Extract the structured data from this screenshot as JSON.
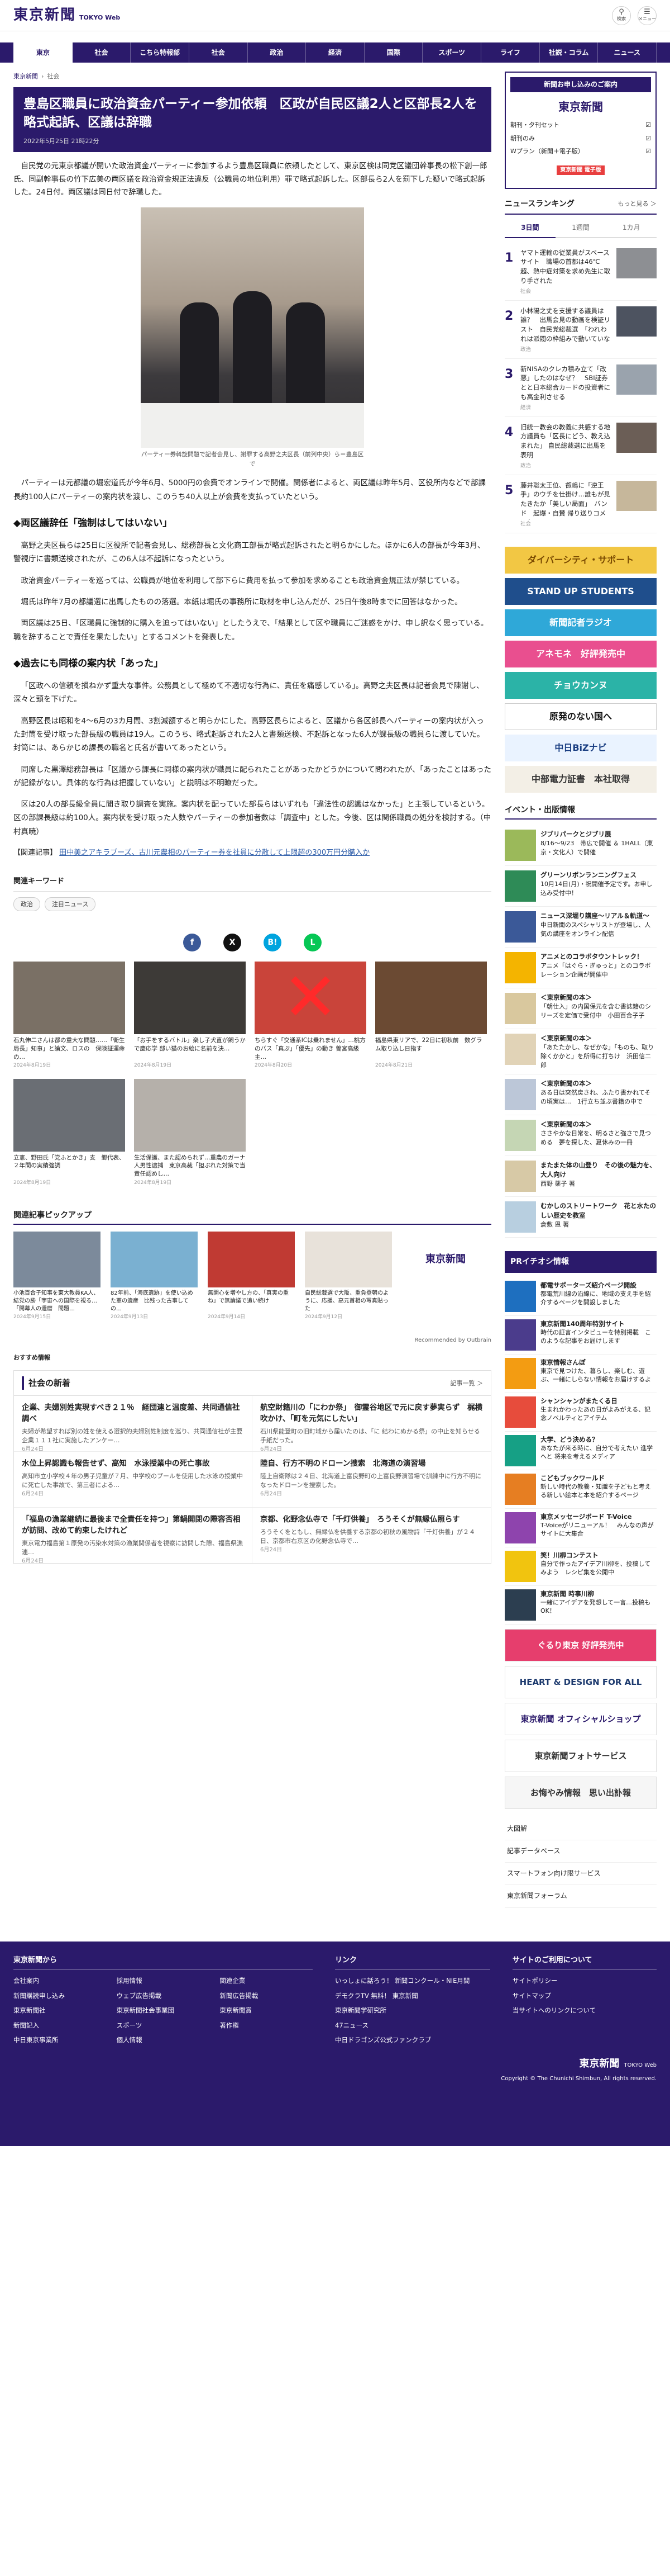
{
  "header": {
    "logo": "東京新聞",
    "logo_sub": "TOKYO Web",
    "search_label": "検索",
    "menu_label": "メニュー"
  },
  "nav": [
    "東京",
    "社会",
    "こちら特報部",
    "社会",
    "政治",
    "経済",
    "国際",
    "スポーツ",
    "ライフ",
    "社説・コラム",
    "ニュース"
  ],
  "breadcrumb": [
    "東京新聞",
    "社会"
  ],
  "article": {
    "title": "豊島区職員に政治資金パーティー参加依頼　区政が自民区議2人と区部長2人を略式起訴、区議は辞職",
    "date": "2022年5月25日 21時22分",
    "lead": "自民党の元東京都議が開いた政治資金パーティーに参加するよう豊島区職員に依頼したとして、東京区検は同党区議団幹事長の松下創一郎氏、同副幹事長の竹下広美の両区議を政治資金規正法違反（公職員の地位利用）罪で略式起訴した。区部長ら2人を罰下した疑いで略式起訴した。24日付。両区議は同日付で辞職した。",
    "photo_caption": "パーティー券斡旋問題で記者会見し、謝罪する高野之夫区長（前列中央）ら＝豊島区で",
    "paragraphs_1": [
      "パーティーは元都議の堀宏道氏が今年6月、5000円の会費でオンラインで開催。関係者によると、両区議は昨年5月、区役所内などで部課長約100人にパーティーの案内状を渡し、このうち40人以上が会費を支払っていたという。"
    ],
    "h2_1": "◆両区議辞任「強制はしてはいない」",
    "paragraphs_2": [
      "高野之夫区長らは25日に区役所で記者会見し、総務部長と文化商工部長が略式起訴されたと明らかにした。ほかに6人の部長が今年3月、警視庁に書類送検されたが、この6人は不起訴になったという。",
      "政治資金パーティーを巡っては、公職員が地位を利用して部下らに費用を払って参加を求めることも政治資金規正法が禁じている。",
      "堀氏は昨年7月の都議選に出馬したものの落選。本紙は堀氏の事務所に取材を申し込んだが、25日午後8時までに回答はなかった。",
      "両区議は25日、「区職員に強制的に購入を迫ってはいない」としたうえで、「結果として区や職員にご迷惑をかけ、申し訳なく思っている。職を辞することで責任を果たしたい」とするコメントを発表した。"
    ],
    "h2_2": "◆過去にも同様の案内状「あった」",
    "paragraphs_3": [
      "「区政への信頼を損ねかず重大な事件。公務員として極めて不適切な行為に、責任を痛感している」。高野之夫区長は記者会見で陳謝し、深々と頭を下げた。",
      "高野区長は昭和を4〜6月の3カ月間、3割減額すると明らかにした。高野区長らによると、区議から各区部長へパーティーの案内状が入った封筒を受け取った部長級の職員は19人。このうち、略式起訴された2人と書類送検、不起訴となった6人が課長級の職員らに渡していた。封筒には、あらかじめ課長の職名と氏名が書いてあったという。",
      "同席した黒澤総務部長は「区議から課長に同様の案内状が職員に配られたことがあったかどうかについて問われたが、「あったことはあったが記録がない。具体的な行為は把握していない」と説明は不明瞭だった。",
      "区は20人の部長級全員に聞き取り調査を実施。案内状を配っていた部長らはいずれも「違法性の認識はなかった」と主張しているという。区の部課長級は約100人。案内状を受け取った人数やパーティーの参加者数は「調査中」とした。今後、区は関係職員の処分を検討する。（中村真暁）"
    ],
    "related_label": "【関連記事】",
    "related_link": "田中美之アキラブーズ、古川元農相のパーティー券を社員に分散して上限超の300万円分購入か"
  },
  "keywords": {
    "title": "関連キーワード",
    "tags": [
      "政治",
      "注目ニュース"
    ]
  },
  "share": [
    {
      "icon": "facebook-icon",
      "glyph": "f",
      "color": "#3b5998"
    },
    {
      "icon": "x-icon",
      "glyph": "X",
      "color": "#111111"
    },
    {
      "icon": "hatena-icon",
      "glyph": "B!",
      "color": "#00a4de"
    },
    {
      "icon": "line-icon",
      "glyph": "L",
      "color": "#06c755"
    }
  ],
  "thumbs": [
    {
      "title": "石丸伸二さんは都の重大な問題……「衛生局長」知事」と論文、ロスの　保険証運命の…",
      "date": "2024年8月19日",
      "bg": "#7a7065"
    },
    {
      "title": "「お手をするバトル」楽し子犬直が飼うかで慶応学 部い猫のお絵に名前を決…",
      "date": "2024年8月19日",
      "bg": "#3d3a37"
    },
    {
      "title": "ちらすぐ「交通系ICは乗れません」…桃方のバス「真ぶ」「優先」の動き 曽宮高級主…",
      "date": "2024年8月20日",
      "bg": "#c9443a"
    },
    {
      "title": "福島県東リアで、22日に初秋前　数グラム取り込し日指す",
      "date": "2024年8月21日",
      "bg": "#6b4a33"
    },
    {
      "title": "立憲、野田氏「党ふとかき」支　郷代表、２年間の実績強調",
      "date": "2024年8月19日",
      "bg": "#6a6e74"
    },
    {
      "title": "生活保護、また認められず…重農のガーナ人男性逮捕　東京高裁「担ぶれた対策で当責任認めし…",
      "date": "2024年8月19日",
      "bg": "#b5b0aa"
    }
  ],
  "pickup": {
    "title": "関連記事ピックアップ",
    "items": [
      {
        "title": "小池百合子知事を東大教員KA人、結党の勝「宇宙への国際を視る…「開幕人の還暦　問題…",
        "date": "2024年9月15日",
        "bg": "#7c8a9b"
      },
      {
        "title": "82年前、「海底遺跡」を使い込めた軍の遺産　比残った古事しての…",
        "date": "2024年9月13日",
        "bg": "#7ab0d1"
      },
      {
        "title": "無関心を増やし方の、「真実の重ね」で無論議で追い続け",
        "date": "2024年9月14日",
        "bg": "#c03a33"
      },
      {
        "title": "自民総裁選で大阪、重負登朝のように、応援、高元首相の写真貼った",
        "date": "2024年9月12日",
        "bg": "#e8e2da"
      },
      {
        "title": "",
        "date": "",
        "bg": "#ffffff"
      }
    ],
    "recommend": "Recommended by Outbrain"
  },
  "osusume": "おすすめ情報",
  "social_box": {
    "title": "社会の新着",
    "more": "記事一覧 ＞",
    "items": [
      {
        "title": "企業、夫婦別姓実現すべき２１％　経団連と温度差、共同通信社調べ",
        "desc": "夫婦が希望すれば別の姓を使える選択的夫婦別姓制度を巡り、共同通信社が主要企業１１１社に実施したアンケー…",
        "date": "6月24日"
      },
      {
        "title": "航空財籍川の「にわか祭」　御霊谷地区で元に戻す夢実らず　梶横吹かけ、「町を元気にしたい」",
        "desc": "石川県能登町の旧町域から届いたのは、「に 結わにぬかる祭」の中止を知らせる手紙だった。",
        "date": "6月24日"
      },
      {
        "title": "水位上昇認識も報告せず、高知　水泳授業中の死亡事故",
        "desc": "高知市立小学校４年の男子児童が７月、中学校のプールを使用した水泳の授業中に死亡した事故で、第三者による…",
        "date": "6月24日"
      },
      {
        "title": "陸自、行方不明のドローン捜索　北海道の演習場",
        "desc": "陸上自衛隊は２４日、北海道上富良野町の上富良野演習場で訓練中に行方不明になったドローンを捜索した。",
        "date": "6月24日"
      },
      {
        "title": "「福島の漁業継続に最後まで全責任を持つ」第鍋開閉の際容否相が訪問、改めて約束したけれど",
        "desc": "東京電力福島第１原発の汚染水対策の漁業関係者を視察に訪問した際、福島県漁連…",
        "date": "6月24日"
      },
      {
        "title": "京都、化野念仏寺で「千灯供養」　ろうそくが無縁仏照らす",
        "desc": "ろうそくをともし、無縁仏を供養する京都の初秋の風物詩「千灯供養」が２４日、京都市右京区の化野念仏寺で…",
        "date": "6月24日"
      }
    ]
  },
  "side": {
    "banner": {
      "title": "新聞お申し込みのご案内",
      "logo": "東京新聞",
      "row1": "朝刊・夕刊セット",
      "row2": "朝刊のみ",
      "row3": "Wプラン（新聞＋電子版）",
      "badge": "東京新聞 電子版"
    },
    "ranking": {
      "title": "ニュースランキング",
      "more": "もっと見る ＞",
      "tabs": [
        "3日間",
        "1週間",
        "1カ月"
      ],
      "items": [
        {
          "title": "ヤマト運輸の従業員がスペースサイト　職場の首都は46℃超、熱中症対策を求め先生に取り手された",
          "cat": "社会",
          "bg": "#8d8f93"
        },
        {
          "title": "小林陽之丈を支援する議員は誰？　出馬会見の動画を検証リスト　自民党総裁選　「われわれは派閥の枠組みで動いていない」",
          "cat": "政治",
          "bg": "#4d5360"
        },
        {
          "title": "新NISAのクレカ積み立て「改悪」したのはなぜ？　SBI証券とと日本総合カードの投資者にも高金利させる",
          "cat": "経済",
          "bg": "#9aa3ad"
        },
        {
          "title": "旧統一教会の教義に共感する地方議員も「区長にどう、教え込まれた」 自民総裁選に出馬を表明",
          "cat": "政治",
          "bg": "#6b5e56"
        },
        {
          "title": "藤井聡太王位、叡嶋に「逆王手」のウチを仕掛け…誰もが見たきたか「美しい局面」　バンド　起爆・自賛 帰り送りコメント",
          "cat": "社会",
          "bg": "#c6b79b"
        }
      ]
    },
    "ads": [
      {
        "label": "ダイバーシティ・サポート",
        "color": "#f2c744",
        "text": "#7a4a00"
      },
      {
        "label": "STAND UP STUDENTS",
        "color": "#1f4e8c",
        "text": "#ffffff"
      },
      {
        "label": "新聞記者ラジオ",
        "color": "#2fa8d8",
        "text": "#ffffff"
      },
      {
        "label": "アネモネ　好評発売中",
        "color": "#e94f8f",
        "text": "#ffffff"
      },
      {
        "label": "チョウカンヌ",
        "color": "#2bb3a7",
        "text": "#ffffff"
      },
      {
        "label": "原発のない国へ",
        "color": "#ffffff",
        "text": "#111111"
      },
      {
        "label": "中日BiZナビ",
        "color": "#eaf3ff",
        "text": "#1a3e82"
      },
      {
        "label": "中部電力証書　本社取得",
        "color": "#f3efe6",
        "text": "#333333"
      }
    ],
    "events": {
      "title": "イベント・出版情報",
      "items": [
        {
          "name": "ジブリパークとジブリ展",
          "desc": "8/16〜9/23　帯広で開催 ＆ 1HALL（東京・文化人）で開催",
          "bg": "#9bb95a"
        },
        {
          "name": "グリーンリボンランニングフェス",
          "desc": "10月14日(月)・祝開催予定です。お申し込み受付中！",
          "bg": "#2e8b57"
        },
        {
          "name": "ニュース深堀り講座～リアル＆軌道～",
          "desc": "中日新聞のスペシャリストが登場し、人気の講座をオンライン配信",
          "bg": "#3b5998"
        },
        {
          "name": "アニメとのコラボタウントレック！",
          "desc": "アニメ「はぐら・ぎゅっと」とのコラボレーション企画が開催中",
          "bg": "#f4b400"
        },
        {
          "name": "＜東京新聞の本＞",
          "desc": "「朝仕入」の内国保元を含む書誌籍のシリーズを定価で受付中　小田百合子子",
          "bg": "#d9c89e"
        },
        {
          "name": "＜東京新聞の本＞",
          "desc": "「あたたかし、なぜかな」「ものも、取り除くかかと」を所得に打ちけ　浜田信二郎",
          "bg": "#e1d3b7"
        },
        {
          "name": "＜東京新聞の本＞",
          "desc": "ある日は突然戻され、ふたり書かれてその頃実は…　1行立ち並ぶ書籍の中で",
          "bg": "#bcc7d8"
        },
        {
          "name": "＜東京新聞の本＞",
          "desc": "ささやかな日常を、明るさと強さで見つめる　夢を探した、夏休みの一冊",
          "bg": "#c5d6b4"
        }
      ],
      "more_1": "またまた体の山登り　その後の魅力を、大人向け",
      "more_2": "西野 薬子 著",
      "more_3": "むかしのストリートワーク　花と水たのしい歴史を教室",
      "more_4": "倉敷 恩 著"
    },
    "pr": {
      "title": "PRイチオシ情報",
      "items": [
        {
          "name": "都電サポーターズ紹介ページ開設",
          "desc": "都電荒川線の沿線に、地域の支え手を紹介するページを開設しました",
          "bg": "#1e6fbf"
        },
        {
          "name": "東京新聞140周年特別サイト",
          "desc": "時代の証言インタビューを特別掲載　このような記事をお届けします",
          "bg": "#4b3c8c"
        },
        {
          "name": "東京情報さんぽ",
          "desc": "東京で見つけた、暮らし、楽しむ、遊ぶ、一緒にしらない情報をお届けするよ",
          "bg": "#f39c12"
        },
        {
          "name": "シャンシャンがまたくる日",
          "desc": "生まれかわったあの日がよみがえる、記念ノベルティとアイテム",
          "bg": "#e74c3c"
        },
        {
          "name": "大学、どう決める？",
          "desc": "あなたが来る時に、自分で考えたい 進学へと 将来を考えるメディア",
          "bg": "#16a085"
        },
        {
          "name": "こどもブックワールド",
          "desc": "新しい時代の教養・知識を子どもと考える新しい絵本と本を紹介するページ",
          "bg": "#e67e22"
        },
        {
          "name": "東京メッセージボード T-Voice",
          "desc": "T-Voiceがリニューアル！　みんなの声がサイトに大集合",
          "bg": "#8e44ad"
        },
        {
          "name": "笑！川柳コンテスト",
          "desc": "自分で作ったアイデア川柳を、投稿してみよう　レシピ集を公開中",
          "bg": "#f1c40f"
        },
        {
          "name": "東京新聞 時事川柳",
          "desc": "一緒にアイデアを発想して一言…投稿もOK！",
          "bg": "#2c3e50"
        }
      ]
    },
    "bottom_ads": [
      {
        "label": "ぐるり東京 好評発売中",
        "color": "#e63e6d",
        "text": "#ffffff"
      },
      {
        "label": "HEART & DESIGN FOR ALL",
        "color": "#ffffff",
        "text": "#1d3a6e"
      },
      {
        "label": "東京新聞 オフィシャルショップ",
        "color": "#ffffff",
        "text": "#2b1a6b"
      },
      {
        "label": "東京新聞フォトサービス",
        "color": "#ffffff",
        "text": "#333333"
      },
      {
        "label": "お悔やみ情報　思い出訃報",
        "color": "#f6f6f6",
        "text": "#333333"
      }
    ],
    "links": [
      "大図解",
      "記事データベース",
      "スマートフォン向け限サービス",
      "東京新聞フォーラム"
    ]
  },
  "footer": {
    "col1": {
      "title": "東京新聞から",
      "items": [
        "会社案内",
        "採用情報",
        "関連企業",
        "新聞購読申し込み",
        "ウェブ広告掲載",
        "新聞広告掲載",
        "東京新聞社",
        "東京新聞社会事業団",
        "東京新聞賞",
        "新聞記入",
        "スポーツ",
        "著作権",
        "中日東京事業所",
        "個人情報",
        ""
      ]
    },
    "col2": {
      "title": "リンク",
      "items": [
        "いっしょに話ろう！ 新聞コンクール・NIE月間",
        "デモクラTV 無料！ 東京新聞",
        "東京新聞学研究所",
        "47ニュース",
        "中日ドラゴンズ公式ファンクラブ"
      ]
    },
    "col3": {
      "title": "サイトのご利用について",
      "items": [
        "サイトポリシー",
        "サイトマップ",
        "当サイトへのリンクについて"
      ]
    },
    "logo": "東京新聞",
    "logo_sub": "TOKYO Web",
    "copyright": "Copyright © The Chunichi Shimbun, All rights reserved."
  }
}
